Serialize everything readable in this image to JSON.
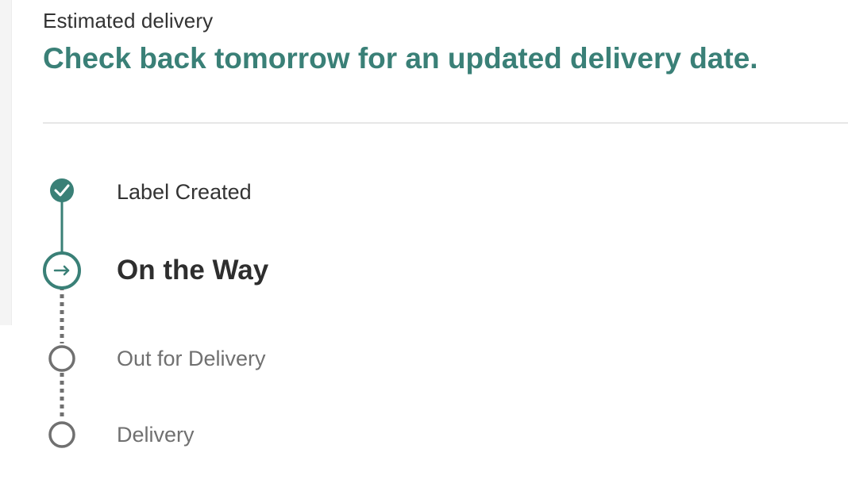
{
  "estimate": {
    "label": "Estimated delivery",
    "message": "Check back tomorrow for an updated delivery date."
  },
  "steps": [
    {
      "label": "Label Created",
      "status": "complete",
      "icon": "check-icon"
    },
    {
      "label": "On the Way",
      "status": "current",
      "icon": "arrow-right-icon"
    },
    {
      "label": "Out for Delivery",
      "status": "pending",
      "icon": "empty-circle-icon"
    },
    {
      "label": "Delivery",
      "status": "pending",
      "icon": "empty-circle-icon"
    }
  ],
  "colors": {
    "accent": "#3a8077",
    "pending": "#707070",
    "text": "#333333"
  }
}
